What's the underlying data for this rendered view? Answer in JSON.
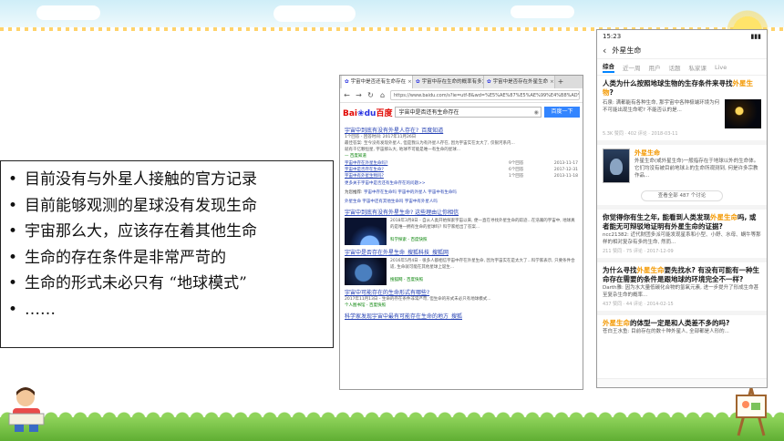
{
  "bullets": [
    "目前没有与外星人接触的官方记录",
    "目前能够观测的星球没有发现生命",
    "宇宙那么大，应该存在着其他生命",
    "生命的存在条件是非常严苛的",
    "生命的形式未必只有 “地球模式”",
    "……"
  ],
  "browser": {
    "tabs": [
      {
        "label": "宇宙中是否还有生命存在"
      },
      {
        "label": "宇宙中存在生命的概率有多大"
      },
      {
        "label": "宇宙中是否存在外星生命"
      }
    ],
    "address": "https://www.baidu.com/s?ie=utf-8&wd=%E5%AE%87%E5%AE%99%E4%B8%AD%E6%98%AF%E5%90%A6%E8%BF%98",
    "logo_main": "Bai",
    "logo_du": "du",
    "logo_suffix": "百度",
    "search_value": "宇宙中是否还有生命存在",
    "search_button": "百度一下",
    "result1_title": "宇宙中到底有没有外星人存在?",
    "result1_source": "_百度知道",
    "result1_meta": "1个回答 - 回答时间: 2017年11月26日",
    "result1_line1": "最佳答案: 至今没有发现外星人, 但是我认为有外星人存在, 因为宇宙实在太大了, 仅银河系内...",
    "result1_line2": "就有千亿颗恒星, 宇宙那么大, 地球不可能是唯一有生命的星球...",
    "qa_heading": "— 百度知道",
    "qa_rows": [
      {
        "q": "宇宙中存在外星生命吗?",
        "c": "9个回答",
        "d": "2013-11-17"
      },
      {
        "q": "宇宙中是否存在生命?",
        "c": "6个回答",
        "d": "2017-12-31"
      },
      {
        "q": "宇宙中有外星生物吗?",
        "c": "1个回答",
        "d": "2013-11-18"
      }
    ],
    "qa_more": "更多关于宇宙中是否还有生命存在的问题>>",
    "related_label": "为您推荐:",
    "related_line1": "宇宙中存在生命吗  宇宙中的外星人  宇宙中有生命吗",
    "related_line2": "外星生命  宇宙中还有其他生命吗  宇宙中有外星人吗",
    "result2_title": "宇宙中到底有没有外星生命? 这些理由让你相信",
    "result2_line1": "2018年3月8日 - 自从人类开始探索宇宙以来, 便一直在寻找外星生命的踪迹...",
    "result2_line2": "在浩瀚的宇宙中, 地球真的是唯一拥有生命的星球吗? 科学家给出了答案...",
    "result2_source": "科学探索 - 百度快照",
    "result3_title": "宇宙中是否存在外星生命_搜狐科技_搜狐网",
    "result3_line1": "2016年5月4日 - 很多人都相信宇宙中存在外星生命, 因为宇宙实在是太大了...",
    "result3_line2": "科学家表示, 只要条件合适, 生命就可能在其他星球上诞生...",
    "result3_source": "搜狐网 - 百度快照",
    "result4_title": "宇宙中可能存在的生命形式有哪些?",
    "result4_line1": "2017年11月13日 - 生命的存在条件非常严苛, 但生命的形式未必只有地球模式...",
    "result4_source": "个人图书馆 - 百度快照",
    "result5_title": "科学家发现宇宙中最有可能存在生命的地方_搜狐"
  },
  "phone": {
    "time": "15:23",
    "battery": "▮▮▮",
    "query": "外星生命",
    "tabs": [
      "综合",
      "近一周",
      "用户",
      "话题",
      "私家课",
      "Live"
    ],
    "card1_title": "人类为什么按照地球生物的生存条件来寻找",
    "card1_title_hl": "外星生物",
    "card1_title_end": "?",
    "card1_text": "石泉: 满都能有各种生命, 那宇宙中各种极端环境为何不可能出现生命呢? 不能否认的是...",
    "card1_meta": "5.3K 赞同 · 402 评论 · 2018-03-11",
    "topic_name": "外星生命",
    "topic_text": "外星生命(或外星生命)一般指存在于地球以外的生命体。它们均没有被目前地球上的生命所观测到, 何是许多宗教作品...",
    "topic_button": "查看全部 487 个讨论",
    "card2_title": "你觉得你有生之年, 能看到人类发现",
    "card2_title_hl": "外星生命",
    "card2_title_end": "吗, 或者能无可辩驳地证明有外星生命的证据?",
    "card2_text": "ncc21382: 近代财团多派可能发现星系和小型、小舒、水母、蜗牛等那样的相对复杂有多的生命, 然而...",
    "card2_meta": "211 赞同 · 75 评论 · 2017-12-09",
    "card3_title": "为什么寻找",
    "card3_title_hl": "外星生命",
    "card3_title_end": "要先找水? 有没有可能有一种生命存在需要的条件是跟地球的环境完全不一样?",
    "card3_text": "Darth雅: 因为水大量低碳化合物的氢氧元素, 进一步提升了形成生命甚至复杂生命的概率...",
    "card3_meta": "437 赞同 · 44 评论 · 2014-02-15",
    "card4_title_hl": "外星生命",
    "card4_title_end": "的体型一定是和人类差不多的吗?",
    "card4_text": "苍白王水鱼: 目前存在的数十种外星人, 全部都是人形的..."
  }
}
